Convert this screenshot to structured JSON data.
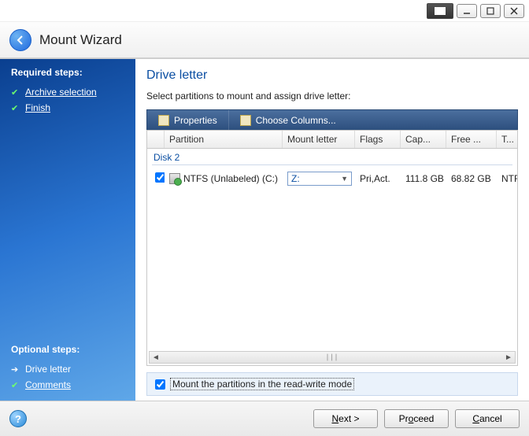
{
  "window": {
    "title": "Mount Wizard"
  },
  "sidebar": {
    "required_title": "Required steps:",
    "required": [
      {
        "label": "Archive selection",
        "done": true
      },
      {
        "label": "Finish",
        "done": true
      }
    ],
    "optional_title": "Optional steps:",
    "optional": [
      {
        "label": "Drive letter",
        "current": true
      },
      {
        "label": "Comments",
        "done": true
      }
    ]
  },
  "main": {
    "heading": "Drive letter",
    "instruction": "Select partitions to mount and assign drive letter:",
    "toolbar": {
      "properties": "Properties",
      "choose_columns": "Choose Columns..."
    },
    "columns": {
      "partition": "Partition",
      "mount": "Mount letter",
      "flags": "Flags",
      "capacity": "Cap...",
      "free": "Free ...",
      "type": "T..."
    },
    "disk_group": "Disk 2",
    "rows": [
      {
        "checked": true,
        "partition": "NTFS (Unlabeled) (C:)",
        "mount_letter": "Z:",
        "flags": "Pri,Act.",
        "capacity": "111.8 GB",
        "free": "68.82 GB",
        "type": "NTFS"
      }
    ],
    "readwrite": {
      "checked": true,
      "label": "Mount the partitions in the read-write mode"
    }
  },
  "footer": {
    "next": "Next >",
    "proceed": "Proceed",
    "cancel": "Cancel"
  }
}
